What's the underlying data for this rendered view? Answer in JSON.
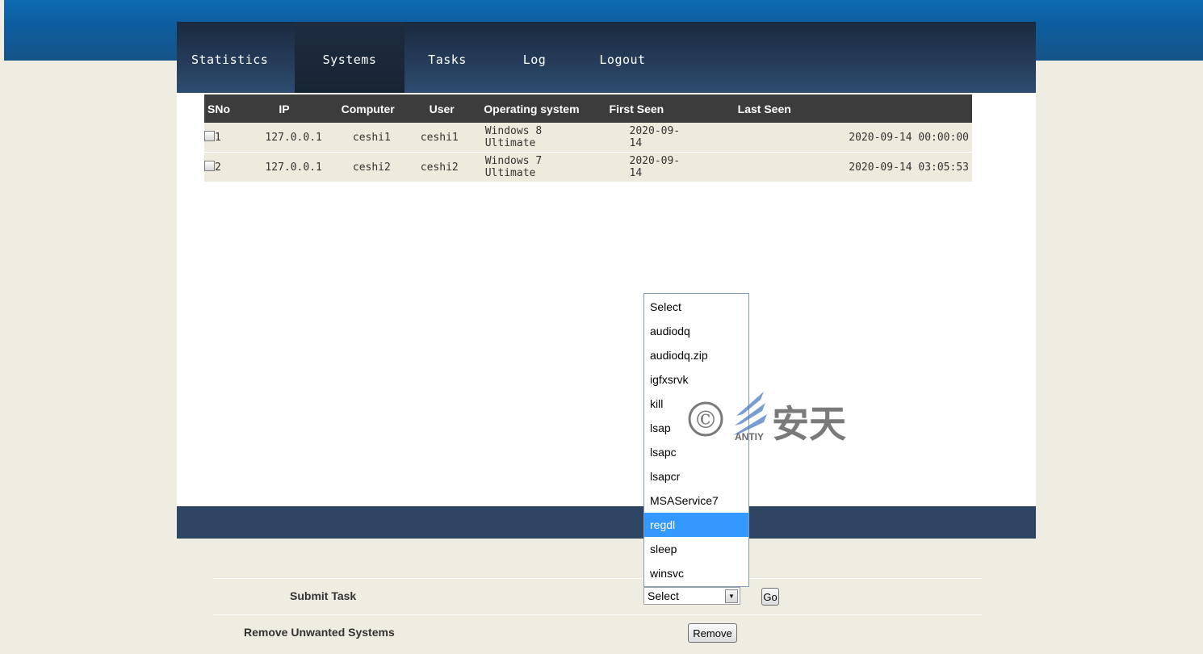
{
  "nav": {
    "items": [
      {
        "label": "Statistics"
      },
      {
        "label": "Systems"
      },
      {
        "label": "Tasks"
      },
      {
        "label": "Log"
      },
      {
        "label": "Logout"
      }
    ],
    "active": "Systems"
  },
  "systems_table": {
    "headers": [
      "SNo",
      "IP",
      "Computer",
      "User",
      "Operating system",
      "First Seen",
      "Last Seen"
    ],
    "rows": [
      {
        "sno": "1",
        "ip": "127.0.0.1",
        "computer": "ceshi1",
        "user": "ceshi1",
        "os": "Windows 8 Ultimate",
        "first_seen": "2020-09-14",
        "last_seen": "2020-09-14 00:00:00"
      },
      {
        "sno": "2",
        "ip": "127.0.0.1",
        "computer": "ceshi2",
        "user": "ceshi2",
        "os": "Windows 7 Ultimate",
        "first_seen": "2020-09-14",
        "last_seen": "2020-09-14 03:05:53"
      }
    ]
  },
  "task_dropdown": {
    "options": [
      "Select",
      "audiodq",
      "audiodq.zip",
      "igfxsrvk",
      "kill",
      "lsap",
      "lsapc",
      "lsapcr",
      "MSAService7",
      "regdl",
      "sleep",
      "winsvc"
    ],
    "highlighted": "regdl"
  },
  "submit_task": {
    "label": "Submit Task",
    "selected_value": "Select",
    "go_label": "Go"
  },
  "remove_systems": {
    "label": "Remove Unwanted Systems",
    "button_label": "Remove"
  },
  "watermark": {
    "text": "安天",
    "sub": "ANTIY",
    "symbol": "©"
  },
  "colors": {
    "last_seen": "#e02020",
    "highlight": "#3399ff",
    "nav_bg": "#253b58"
  }
}
